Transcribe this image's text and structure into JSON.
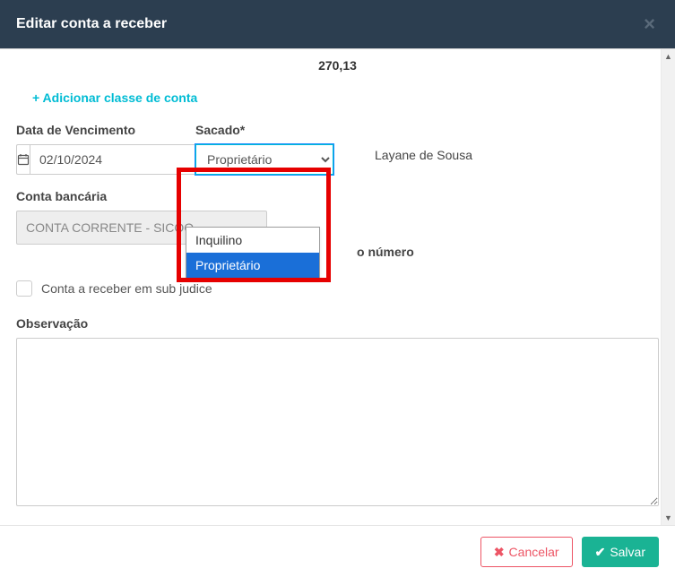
{
  "header": {
    "title": "Editar conta a receber"
  },
  "topValue": "270,13",
  "addClassLink": "+ Adicionar classe de conta",
  "dateField": {
    "label": "Data de Vencimento",
    "value": "02/10/2024"
  },
  "sacado": {
    "label": "Sacado*",
    "selected": "Proprietário",
    "options": [
      "Inquilino",
      "Proprietário"
    ]
  },
  "personName": "Layane de Sousa",
  "bankAccount": {
    "label": "Conta bancária",
    "value": "CONTA CORRENTE - SICOO"
  },
  "docNumberPartial": "o número",
  "subJudice": {
    "label": "Conta a receber em sub judice",
    "checked": false
  },
  "observation": {
    "label": "Observação",
    "value": ""
  },
  "footer": {
    "cancel": "Cancelar",
    "save": "Salvar"
  }
}
